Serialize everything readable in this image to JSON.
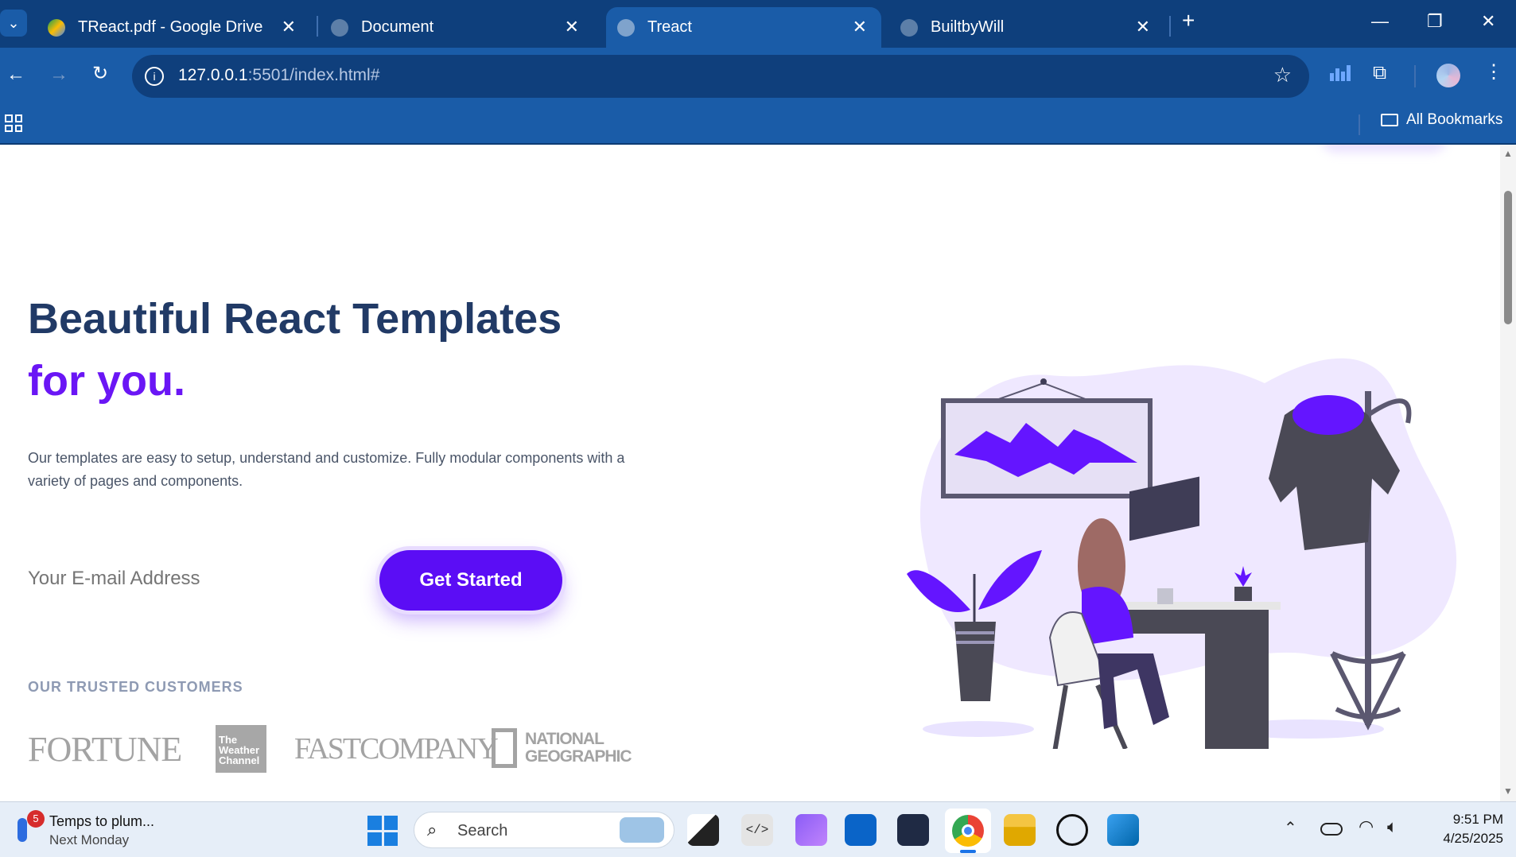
{
  "browser": {
    "tabs": [
      {
        "label": "TReact.pdf - Google Drive",
        "icon": "google-drive-icon"
      },
      {
        "label": "Document",
        "icon": "globe-icon"
      },
      {
        "label": "Treact",
        "icon": "globe-icon",
        "active": true
      },
      {
        "label": "BuiltbyWill",
        "icon": "globe-icon"
      }
    ],
    "url_host": "127.0.0.1",
    "url_rest": ":5501/index.html#",
    "bookmarks_label": "All Bookmarks"
  },
  "hero": {
    "title_line1": "Beautiful React Templates",
    "title_line2": "for you.",
    "description": "Our templates are easy to setup, understand and customize. Fully modular components with a variety of pages and components.",
    "email_placeholder": "Your E-mail Address",
    "cta_label": "Get Started",
    "trusted_heading": "OUR TRUSTED CUSTOMERS",
    "logos": [
      "FORTUNE",
      "The Weather Channel",
      "FASTCOMPANY",
      "NATIONAL GEOGRAPHIC"
    ]
  },
  "taskbar": {
    "weather_badge": "5",
    "weather_title": "Temps to plum...",
    "weather_sub": "Next Monday",
    "search_placeholder": "Search",
    "time": "9:51 PM",
    "date": "4/25/2025"
  },
  "colors": {
    "accent": "#6415ff",
    "heading": "#243e63",
    "chrome": "#0f4a8f"
  }
}
